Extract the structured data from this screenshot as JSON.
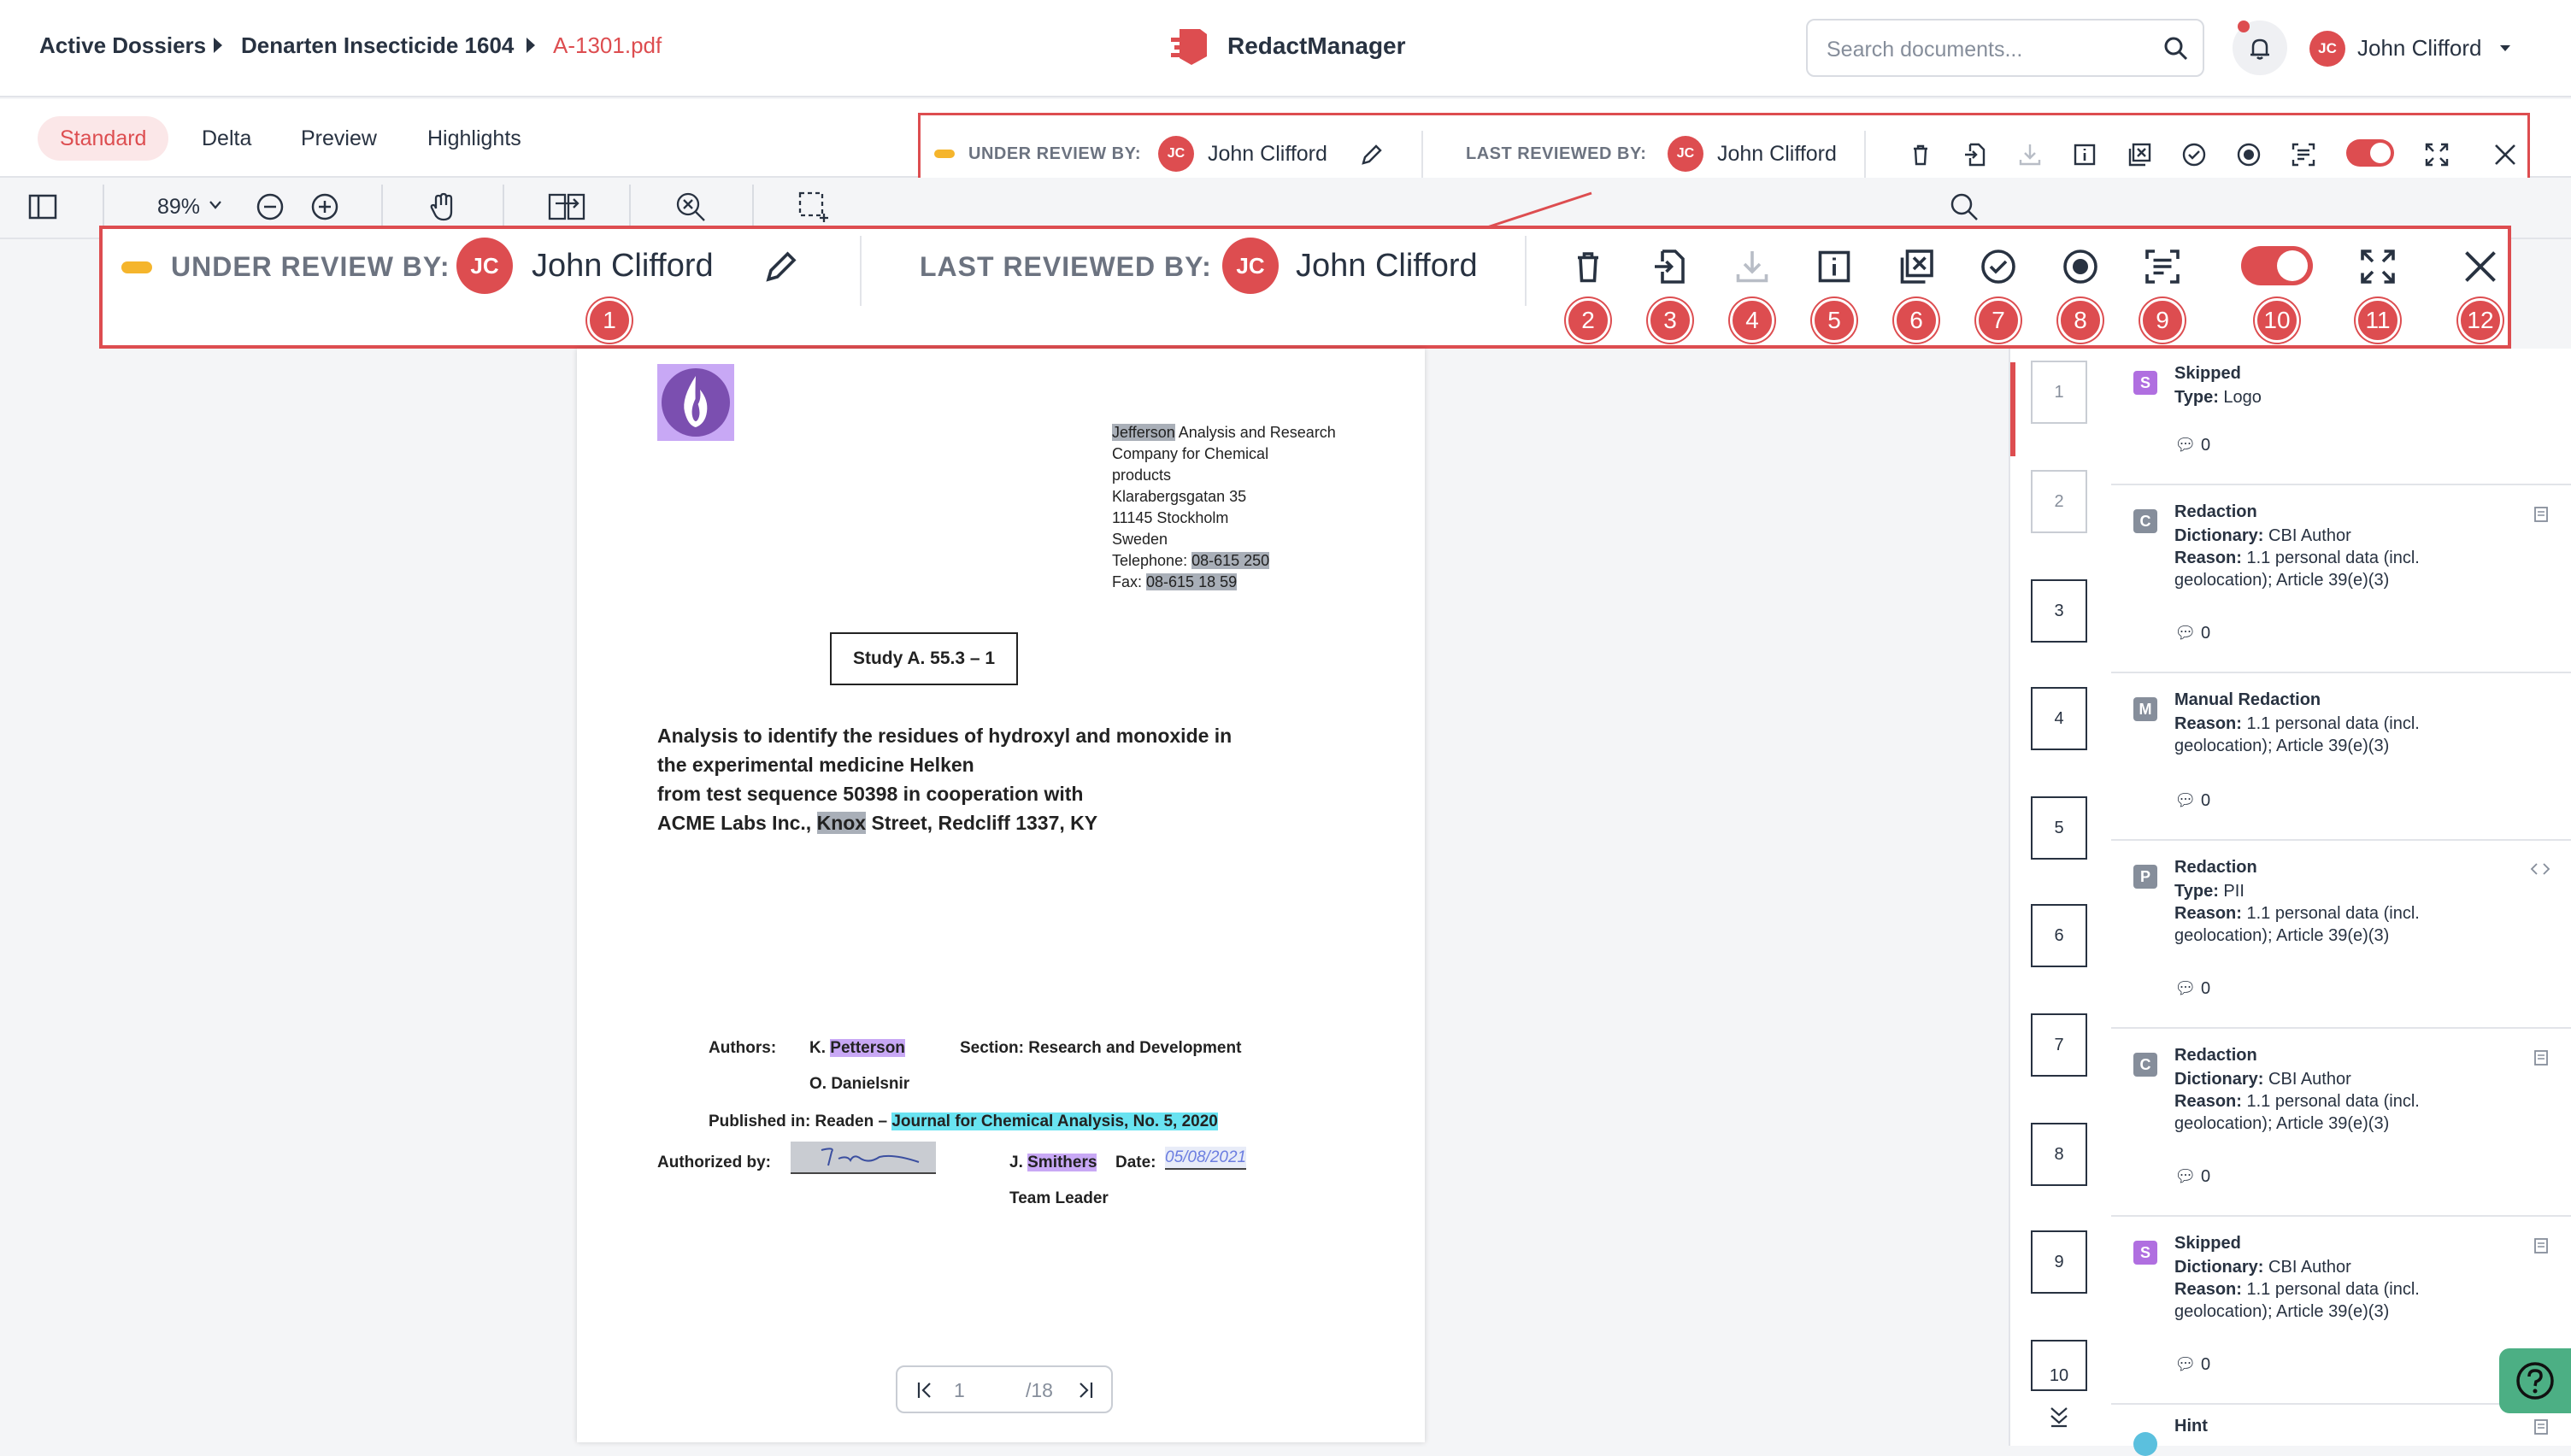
{
  "breadcrumb": [
    "Active Dossiers",
    "Denarten Insecticide 1604",
    "A-1301.pdf"
  ],
  "app": {
    "name": "RedactManager"
  },
  "search": {
    "placeholder": "Search documents..."
  },
  "user": {
    "initials": "JC",
    "name": "John Clifford"
  },
  "view_tabs": [
    {
      "label": "Standard",
      "active": true
    },
    {
      "label": "Delta",
      "active": false
    },
    {
      "label": "Preview",
      "active": false
    },
    {
      "label": "Highlights",
      "active": false
    }
  ],
  "zoom": {
    "value": "89%"
  },
  "review": {
    "under_label": "UNDER REVIEW BY:",
    "under_initials": "JC",
    "under_name": "John Clifford",
    "last_label": "LAST REVIEWED BY:",
    "last_initials": "JC",
    "last_name": "John Clifford"
  },
  "callouts": [
    "1",
    "2",
    "3",
    "4",
    "5",
    "6",
    "7",
    "8",
    "9",
    "10",
    "11",
    "12"
  ],
  "colors": {
    "accent": "#dd4d50",
    "status_yellow": "#f5b52c",
    "gray_hl": "#a9afb8",
    "purple_hl": "#c8a8f5",
    "cyan_hl": "#69e3f1",
    "help": "#4caf84"
  },
  "doc": {
    "address": {
      "line1_hl": "Jefferson",
      "line1_rest": " Analysis and Research",
      "line2": "Company for Chemical",
      "line3": "products",
      "line4": "Klarabergsgatan 35",
      "line5": "11145 Stockholm",
      "line6": "Sweden",
      "tel_label": "Telephone: ",
      "tel_value": "08-615 250",
      "fax_label": "Fax: ",
      "fax_value": "08-615 18 59"
    },
    "study_box": "Study A. 55.3 – 1",
    "title_l1": "Analysis to identify the residues of hydroxyl and monoxide in",
    "title_l2": "the experimental medicine Helken",
    "title_l3": "from test sequence 50398 in cooperation with",
    "title_l4a": "ACME Labs Inc., ",
    "title_l4b": "Knox",
    "title_l4c": " Street, Redcliff 1337, KY",
    "authors_label": "Authors:",
    "author1_init": "K. ",
    "author1_name": "Petterson",
    "section": "Section: Research and Development",
    "author2": "O. Danielsnir",
    "published_label": "Published in: Readen – ",
    "journal": "Journal for Chemical Analysis, No. 5, 2020",
    "authorized_label": "Authorized by:",
    "signer_init": "J. ",
    "signer_name": "Smithers",
    "date_label": "Date:",
    "date_value": "05/08/2021",
    "team_leader": "Team Leader",
    "signature_text": "J. Smith"
  },
  "pager": {
    "current": "1",
    "total": "/18"
  },
  "thumbs": [
    "1",
    "2",
    "3",
    "4",
    "5",
    "6",
    "7",
    "8",
    "9",
    "10"
  ],
  "annotations": [
    {
      "chip": "S",
      "chip_color": "#b06fe0",
      "title": "Skipped",
      "lines": [
        {
          "k": "Type: ",
          "v": "Logo"
        }
      ],
      "count": "0"
    },
    {
      "chip": "C",
      "chip_color": "#868e9b",
      "title": "Redaction",
      "lines": [
        {
          "k": "Dictionary: ",
          "v": "CBI Author"
        },
        {
          "k": "Reason: ",
          "v": "1.1 personal data (incl."
        },
        {
          "k": "",
          "v": "geolocation); Article 39(e)(3)"
        }
      ],
      "count": "0"
    },
    {
      "chip": "M",
      "chip_color": "#868e9b",
      "title": "Manual Redaction",
      "lines": [
        {
          "k": "Reason: ",
          "v": "1.1 personal data (incl."
        },
        {
          "k": "",
          "v": "geolocation); Article 39(e)(3)"
        }
      ],
      "count": "0"
    },
    {
      "chip": "P",
      "chip_color": "#868e9b",
      "title": "Redaction",
      "lines": [
        {
          "k": "Type: ",
          "v": "PII"
        },
        {
          "k": "Reason: ",
          "v": "1.1 personal data (incl."
        },
        {
          "k": "",
          "v": "geolocation); Article 39(e)(3)"
        }
      ],
      "count": "0"
    },
    {
      "chip": "C",
      "chip_color": "#868e9b",
      "title": "Redaction",
      "lines": [
        {
          "k": "Dictionary: ",
          "v": "CBI Author"
        },
        {
          "k": "Reason: ",
          "v": "1.1 personal data (incl."
        },
        {
          "k": "",
          "v": "geolocation); Article 39(e)(3)"
        }
      ],
      "count": "0"
    },
    {
      "chip": "S",
      "chip_color": "#b06fe0",
      "title": "Skipped",
      "lines": [
        {
          "k": "Dictionary: ",
          "v": "CBI Author"
        },
        {
          "k": "Reason: ",
          "v": "1.1 personal data (incl."
        },
        {
          "k": "",
          "v": "geolocation); Article 39(e)(3)"
        }
      ],
      "count": "0"
    },
    {
      "chip": "",
      "chip_color": "#5bc0de",
      "title": "Hint",
      "lines": [],
      "count": ""
    }
  ]
}
